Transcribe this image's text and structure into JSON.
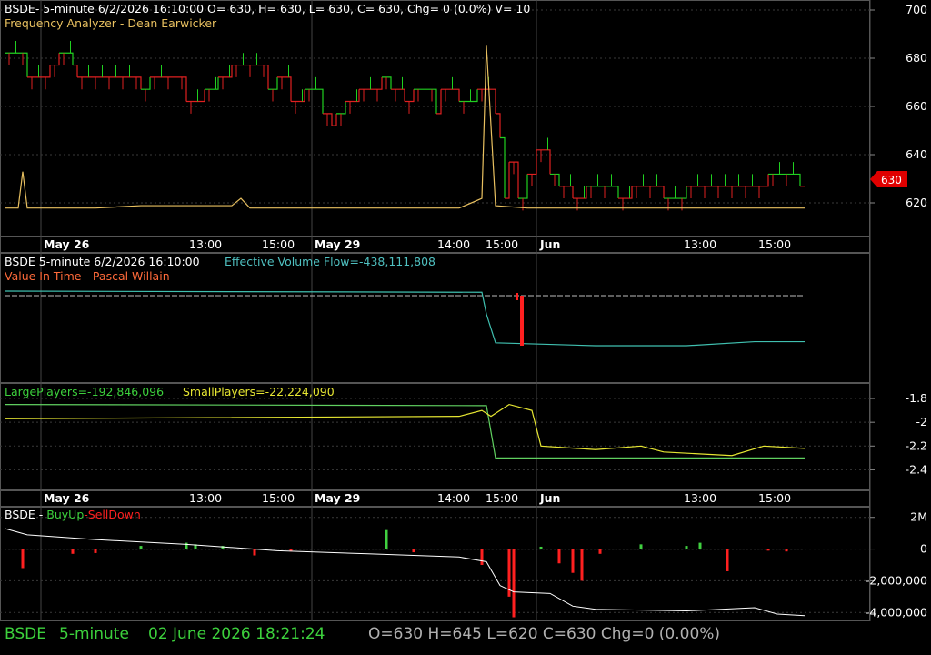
{
  "colors": {
    "price_down": "#e02020",
    "price_up": "#20d020",
    "freq_line": "#e8c060",
    "evf_line": "#40c0b0",
    "vit_bar": "#ff2020",
    "large_line": "#60d060",
    "small_line": "#e6e632",
    "buyup": "#40d040",
    "selldown": "#ff2020",
    "grid": "#3a3a3a",
    "axis_text": "#ffffff",
    "badge": "#e00000"
  },
  "panel1": {
    "header": "BSDE- 5-minute 6/2/2026 16:10:00 O= 630, H= 630, L= 630, C= 630, Chg= 0 (0.0%) V= 10",
    "indicator": "Frequency Analyzer - Dean Earwicker",
    "y_ticks": [
      "700",
      "680",
      "660",
      "640",
      "620"
    ],
    "last_price": "630"
  },
  "panel2": {
    "header": "BSDE 5-minute  6/2/2026 16:10:00",
    "evf_label": "Effective Volume Flow=-438,111,808",
    "indicator": "Value In Time - Pascal Willain"
  },
  "panel3": {
    "large_label": "LargePlayers=-192,846,096",
    "small_label": "SmallPlayers=-22,224,090",
    "y_ticks": [
      "-1.8",
      "-2",
      "-2.2",
      "-2.4"
    ]
  },
  "panel4": {
    "title": "BSDE - ",
    "buy": "BuyUp",
    "dash": "-",
    "sell": "SellDown",
    "y_ticks": [
      "2M",
      "0",
      "-2,000,000",
      "-4,000,000"
    ]
  },
  "x_axis": [
    "May 26",
    "13:00",
    "15:00",
    "May 29",
    "14:00",
    "15:00",
    "Jun",
    "13:00",
    "15:00"
  ],
  "status": {
    "symbol": "BSDE",
    "interval": "5-minute",
    "datetime": "02 June 2026 18:21:24",
    "ohlc": "O=630  H=645  L=620  C=630  Chg=0 (0.00%)"
  },
  "chart_data": [
    {
      "type": "line",
      "name": "price",
      "ylim": [
        610,
        705
      ],
      "x_index_max": 295,
      "segments": [
        [
          0,
          685
        ],
        [
          10,
          675
        ],
        [
          20,
          680
        ],
        [
          24,
          685
        ],
        [
          30,
          680
        ],
        [
          32,
          675
        ],
        [
          60,
          670
        ],
        [
          64,
          675
        ],
        [
          80,
          665
        ],
        [
          88,
          670
        ],
        [
          94,
          675
        ],
        [
          100,
          680
        ],
        [
          116,
          670
        ],
        [
          120,
          675
        ],
        [
          126,
          665
        ],
        [
          132,
          670
        ],
        [
          140,
          660
        ],
        [
          144,
          655
        ],
        [
          146,
          660
        ],
        [
          150,
          665
        ],
        [
          156,
          670
        ],
        [
          166,
          675
        ],
        [
          170,
          670
        ],
        [
          176,
          665
        ],
        [
          180,
          670
        ],
        [
          190,
          660
        ],
        [
          192,
          670
        ],
        [
          200,
          665
        ],
        [
          208,
          670
        ],
        [
          216,
          660
        ],
        [
          218,
          650
        ],
        [
          220,
          625
        ],
        [
          222,
          640
        ],
        [
          226,
          625
        ],
        [
          230,
          635
        ],
        [
          234,
          645
        ],
        [
          240,
          635
        ],
        [
          244,
          630
        ],
        [
          250,
          625
        ],
        [
          256,
          630
        ],
        [
          270,
          625
        ],
        [
          276,
          630
        ],
        [
          290,
          625
        ],
        [
          300,
          630
        ],
        [
          330,
          630
        ],
        [
          336,
          635
        ],
        [
          350,
          630
        ],
        [
          352,
          630
        ]
      ]
    },
    {
      "type": "line",
      "name": "frequency",
      "ylim": [
        610,
        705
      ],
      "values": [
        [
          0,
          621
        ],
        [
          6,
          621
        ],
        [
          8,
          636
        ],
        [
          10,
          621
        ],
        [
          40,
          621
        ],
        [
          60,
          622
        ],
        [
          100,
          622
        ],
        [
          104,
          625
        ],
        [
          108,
          621
        ],
        [
          200,
          621
        ],
        [
          210,
          625
        ],
        [
          212,
          688
        ],
        [
          216,
          622
        ],
        [
          230,
          621
        ],
        [
          352,
          621
        ]
      ]
    },
    {
      "type": "line",
      "name": "evf",
      "values": [
        [
          0,
          -0.1
        ],
        [
          210,
          -0.12
        ],
        [
          212,
          -0.5
        ],
        [
          216,
          -1.0
        ],
        [
          260,
          -1.05
        ],
        [
          300,
          -1.05
        ],
        [
          330,
          -0.98
        ],
        [
          352,
          -0.98
        ]
      ]
    },
    {
      "type": "line",
      "series": [
        {
          "name": "LargePlayers",
          "values": [
            [
              0,
              -1.85
            ],
            [
              212,
              -1.86
            ],
            [
              216,
              -2.3
            ],
            [
              330,
              -2.3
            ],
            [
              352,
              -2.3
            ]
          ]
        },
        {
          "name": "SmallPlayers",
          "values": [
            [
              0,
              -1.97
            ],
            [
              200,
              -1.95
            ],
            [
              210,
              -1.9
            ],
            [
              214,
              -1.95
            ],
            [
              222,
              -1.85
            ],
            [
              232,
              -1.9
            ],
            [
              236,
              -2.2
            ],
            [
              260,
              -2.23
            ],
            [
              280,
              -2.2
            ],
            [
              290,
              -2.25
            ],
            [
              320,
              -2.28
            ],
            [
              334,
              -2.2
            ],
            [
              352,
              -2.22
            ]
          ]
        }
      ],
      "ylim": [
        -2.55,
        -1.7
      ]
    },
    {
      "type": "bar",
      "name": "BuyUp-SellDown",
      "ylim": [
        -4500000,
        2500000
      ],
      "bars": [
        [
          8,
          -1200000
        ],
        [
          30,
          -300000
        ],
        [
          40,
          -250000
        ],
        [
          60,
          200000
        ],
        [
          80,
          400000
        ],
        [
          84,
          300000
        ],
        [
          96,
          200000
        ],
        [
          110,
          -400000
        ],
        [
          126,
          -150000
        ],
        [
          168,
          1200000
        ],
        [
          180,
          -200000
        ],
        [
          210,
          -1000000
        ],
        [
          222,
          -3000000
        ],
        [
          224,
          -4300000
        ],
        [
          236,
          150000
        ],
        [
          244,
          -900000
        ],
        [
          250,
          -1500000
        ],
        [
          254,
          -2000000
        ],
        [
          262,
          -300000
        ],
        [
          280,
          300000
        ],
        [
          300,
          200000
        ],
        [
          306,
          400000
        ],
        [
          318,
          -1400000
        ],
        [
          336,
          -100000
        ],
        [
          344,
          -150000
        ]
      ],
      "cumulative": [
        [
          0,
          1300000
        ],
        [
          10,
          900000
        ],
        [
          40,
          600000
        ],
        [
          80,
          300000
        ],
        [
          120,
          -100000
        ],
        [
          160,
          -300000
        ],
        [
          200,
          -500000
        ],
        [
          212,
          -800000
        ],
        [
          218,
          -2300000
        ],
        [
          224,
          -2700000
        ],
        [
          240,
          -2800000
        ],
        [
          250,
          -3600000
        ],
        [
          260,
          -3800000
        ],
        [
          300,
          -3900000
        ],
        [
          330,
          -3700000
        ],
        [
          340,
          -4100000
        ],
        [
          352,
          -4200000
        ]
      ]
    }
  ]
}
